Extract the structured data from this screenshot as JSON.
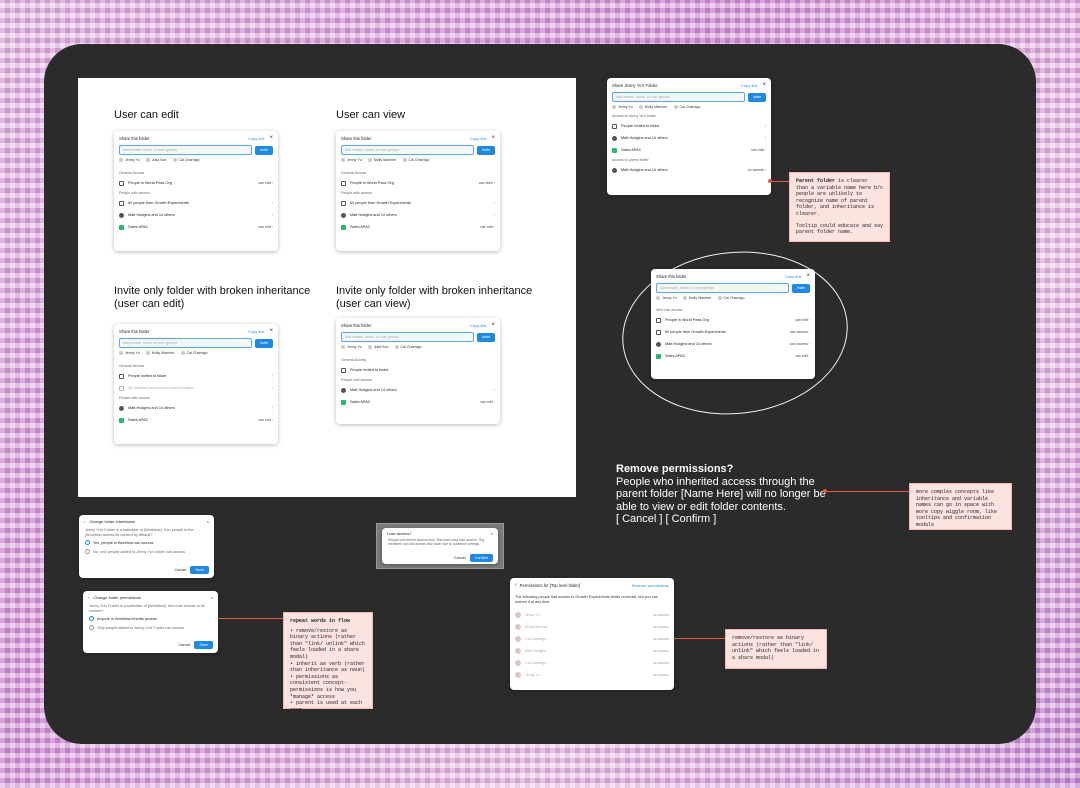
{
  "panels": {
    "user_can_edit": {
      "title": "User can edit",
      "dialog": {
        "title": "Share this folder",
        "copy": "Copy link",
        "placeholder": "Add emails, name, or user groups",
        "invite": "Invite",
        "chips": [
          "Jenny Yu",
          "Julia Sun",
          "Cai Charnigo"
        ],
        "sec1": "General Access",
        "r1": "People in World Peas Org",
        "r1v": "can edit",
        "sec2": "People with access",
        "r2": "60 people from Growth Experiments",
        "r3": "Matt Hodgins and 14 others",
        "r4": "Sales APAC",
        "r4v": "can edit"
      }
    },
    "user_can_view": {
      "title": "User can view",
      "dialog": {
        "title": "Share this folder",
        "copy": "Copy link",
        "placeholder": "Add emails, name, or user groups",
        "invite": "Invite",
        "chips": [
          "Jenny Yu",
          "Molly Marriner",
          "Cai Charnigo"
        ],
        "sec1": "General Access",
        "r1": "People in World Peas Org",
        "r1v": "can view",
        "sec2": "People with access",
        "r2": "60 people from Growth Experiments",
        "r3": "Matt Hodgins and 14 others",
        "r4": "Sales APAC",
        "r4v": "can edit"
      }
    },
    "broken_edit": {
      "title": "Invite only folder with broken inheritance (user can edit)",
      "dialog": {
        "title": "Share this folder",
        "copy": "Copy link",
        "placeholder": "Add emails, name, or user groups",
        "invite": "Invite",
        "chips": [
          "Jenny Yu",
          "Molly Marriner",
          "Cai Charnigo"
        ],
        "sec1": "General Access",
        "r1": "People invited to folder",
        "r1b": "No inherited access from parent folders",
        "sec2": "People with access",
        "r3": "Matt Hodgins and 14 others",
        "r4": "Sales APAC",
        "r4v": "can edit"
      }
    },
    "broken_view": {
      "title": "Invite only folder with broken inheritance (user can view)",
      "dialog": {
        "title": "Share this folder",
        "copy": "Copy link",
        "placeholder": "Add emails, name, or user groups",
        "invite": "Invite",
        "chips": [
          "Jenny Yu",
          "Julia Sun",
          "Cai Charnigo"
        ],
        "sec1": "General Access",
        "r1": "People invited to folder",
        "sec2": "People with access",
        "r3": "Matt Hodgins and 14 others",
        "r4": "Sales APAC",
        "r4v": "can edit"
      }
    }
  },
  "jenny_dialog": {
    "title": "Share Jenny Yu's Folder",
    "copy": "Copy link",
    "placeholder": "Add emails, name, or user groups",
    "invite": "Invite",
    "chips": [
      "Jenny Yu",
      "Molly Marriner",
      "Cai Charnigo"
    ],
    "sec1": "Access to Jenny Yu's folder",
    "r1": "People invited to folder",
    "r2": "Matt Hodgins and 14 others",
    "r3": "Sales APAC",
    "r3v": "can edit",
    "sec2": "Access to parent folder",
    "r4": "Matt Hodgins and 14 others",
    "r4v": "no access"
  },
  "circled_dialog": {
    "title": "Share this folder",
    "copy": "Copy link",
    "placeholder": "Add emails, name, or user groups",
    "invite": "Invite",
    "chips": [
      "Jenny Yu",
      "Molly Marriner",
      "Cai Charnigo"
    ],
    "sec1": "Who has access",
    "r1": "People in World Peas Org",
    "r1v": "can edit",
    "r2": "60 people from Growth Experiments",
    "r2v": "can access",
    "r3": "Matt Hodgins and 14 others",
    "r3v": "can access",
    "r4": "Sales APAC",
    "r4v": "can edit"
  },
  "note_parent": {
    "bold": "Parent folder",
    "text": " is clearer than a variable name here b/c people are unlikely to recognize name of parent folder, and inheritance is clearer.",
    "text2": "Tooltip could educate and say parent folder name."
  },
  "remove": {
    "title": "Remove permissions?",
    "body": "People who inherited access through the parent folder [Name Here] will no longer be able to view or edit folder contents.",
    "actions": "[ Cancel ] [ Confirm ]"
  },
  "note_complex": {
    "text": "more complex concepts like inheritance and variable names can go in space with more copy wiggle room, like tooltips and confirmation modals"
  },
  "change_inheritance": {
    "title": "Change folder inheritance",
    "body": "Jenny Yu's Folder is a subfolder of [Workflow]. Can people in the [Workflow access its content by default?",
    "opt1": "Yes, people in Workflow can access",
    "opt2": "No, only people added to Jenny Yu's folder can access",
    "cancel": "Cancel",
    "save": "Save"
  },
  "lose_access": {
    "title": "Lose access?",
    "body": "People who inherit access from Test team may lose access. Org members can still access this folder due to audience settings.",
    "cancel": "Cancel",
    "confirm": "Confirm"
  },
  "change_perms": {
    "title": "Change folder permissions",
    "body": "Jenny Yu's Folder is a subfolder of [Workflow]. Who has access to its content?",
    "opt1": "Anyone in Workflow inherits access",
    "opt2": "Only people added to Jenny Yu's Folder can access",
    "cancel": "Cancel",
    "save": "Save"
  },
  "note_repeat": {
    "title": "repeat words in flow",
    "items": [
      "remove/restore as binary actions (rather than \"link/ unlink\" which feels loaded in a share modal)",
      "inherit as verb (rather than inheritance as noun)",
      "permissions as consistent concept-permissions is how you *manage* access",
      "parent is used at each step"
    ]
  },
  "perms_dialog": {
    "title": "Permissions for [Top level folder]",
    "remove": "Remove permissions",
    "body": "The following people had access to Growth Experiments folder removed, but you can restore it at any time.",
    "people": [
      "Jenny Yu",
      "Molly Marriner",
      "Cai Charnigo",
      "Matt Hodgins",
      "Cai Charnigo",
      "Jenny Yu"
    ],
    "status": "no access"
  },
  "note_restore": {
    "text": "remove/restore as binary actions (rather than \"link/ unlink\" which feels loaded in a share modal)"
  }
}
